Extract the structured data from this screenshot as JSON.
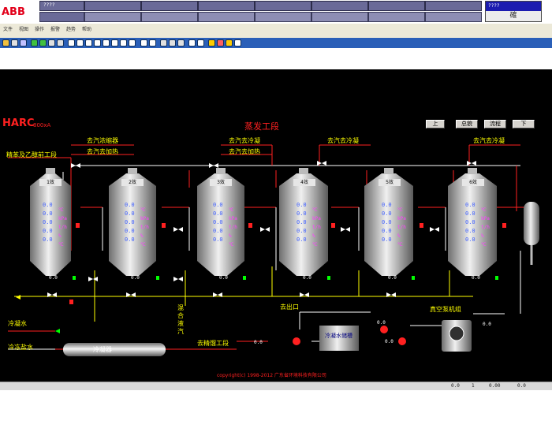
{
  "topbar": {
    "logo": "ABB",
    "cell1_text": "????",
    "right_box_header": "????",
    "right_box_value": "確"
  },
  "menubar": {
    "items": [
      "文件",
      "视图",
      "操作",
      "报警",
      "趋势",
      "帮助"
    ]
  },
  "screen": {
    "brand": "HARC",
    "brand_sub": "800xA",
    "title": "蒸发工段",
    "buttons": [
      "上",
      "总貌",
      "流程",
      "下"
    ],
    "labels": {
      "top_left_1": "去汽浓缩器",
      "top_left_2": "去汽去加热",
      "left_feed": "精苯及乙醇前工段",
      "mid_1": "去汽去冷凝",
      "mid_2": "去汽去加热",
      "right_1": "去汽去冷凝",
      "right_2": "去汽去冷凝",
      "bottom_left_1": "冷凝水",
      "bottom_left_2": "冷冻盐水",
      "preheater": "冷凝器",
      "mixer": "混合液汽",
      "to_process": "去精馏工段",
      "tank_label": "去出口",
      "storage": "冷凝水储槽",
      "pump_room": "真空泵机组",
      "copyright": "copyright(c) 1998-2012 广东省环境科技有限公司"
    },
    "effects": [
      {
        "tag": "1效",
        "values": [
          "0.0",
          "0.0",
          "0.0",
          "0.0",
          "0.0"
        ],
        "units": [
          "℃",
          "kPa",
          "t/h",
          "%",
          "℃"
        ]
      },
      {
        "tag": "2效",
        "values": [
          "0.0",
          "0.0",
          "0.0",
          "0.0",
          "0.0"
        ],
        "units": [
          "℃",
          "kPa",
          "t/h",
          "%",
          "℃"
        ]
      },
      {
        "tag": "3效",
        "values": [
          "0.0",
          "0.0",
          "0.0",
          "0.0",
          "0.0"
        ],
        "units": [
          "℃",
          "kPa",
          "t/h",
          "%",
          "℃"
        ]
      },
      {
        "tag": "4效",
        "values": [
          "0.0",
          "0.0",
          "0.0",
          "0.0",
          "0.0"
        ],
        "units": [
          "℃",
          "kPa",
          "t/h",
          "%",
          "℃"
        ]
      },
      {
        "tag": "5效",
        "values": [
          "0.0",
          "0.0",
          "0.0",
          "0.0",
          "0.0"
        ],
        "units": [
          "℃",
          "kPa",
          "t/h",
          "%",
          "℃"
        ]
      },
      {
        "tag": "6效",
        "values": [
          "0.0",
          "0.0",
          "0.0",
          "0.0",
          "0.0"
        ],
        "units": [
          "℃",
          "kPa",
          "t/h",
          "%",
          "℃"
        ]
      }
    ],
    "pump_values": [
      "0.0",
      "0.0",
      "0.0",
      "0.0",
      "0.0",
      "0.0"
    ],
    "misc_values": [
      "0.0",
      "0.0",
      "0.0",
      "0.0"
    ]
  },
  "status": {
    "items": [
      "0.0",
      "1",
      "0.00",
      "0.0"
    ]
  }
}
